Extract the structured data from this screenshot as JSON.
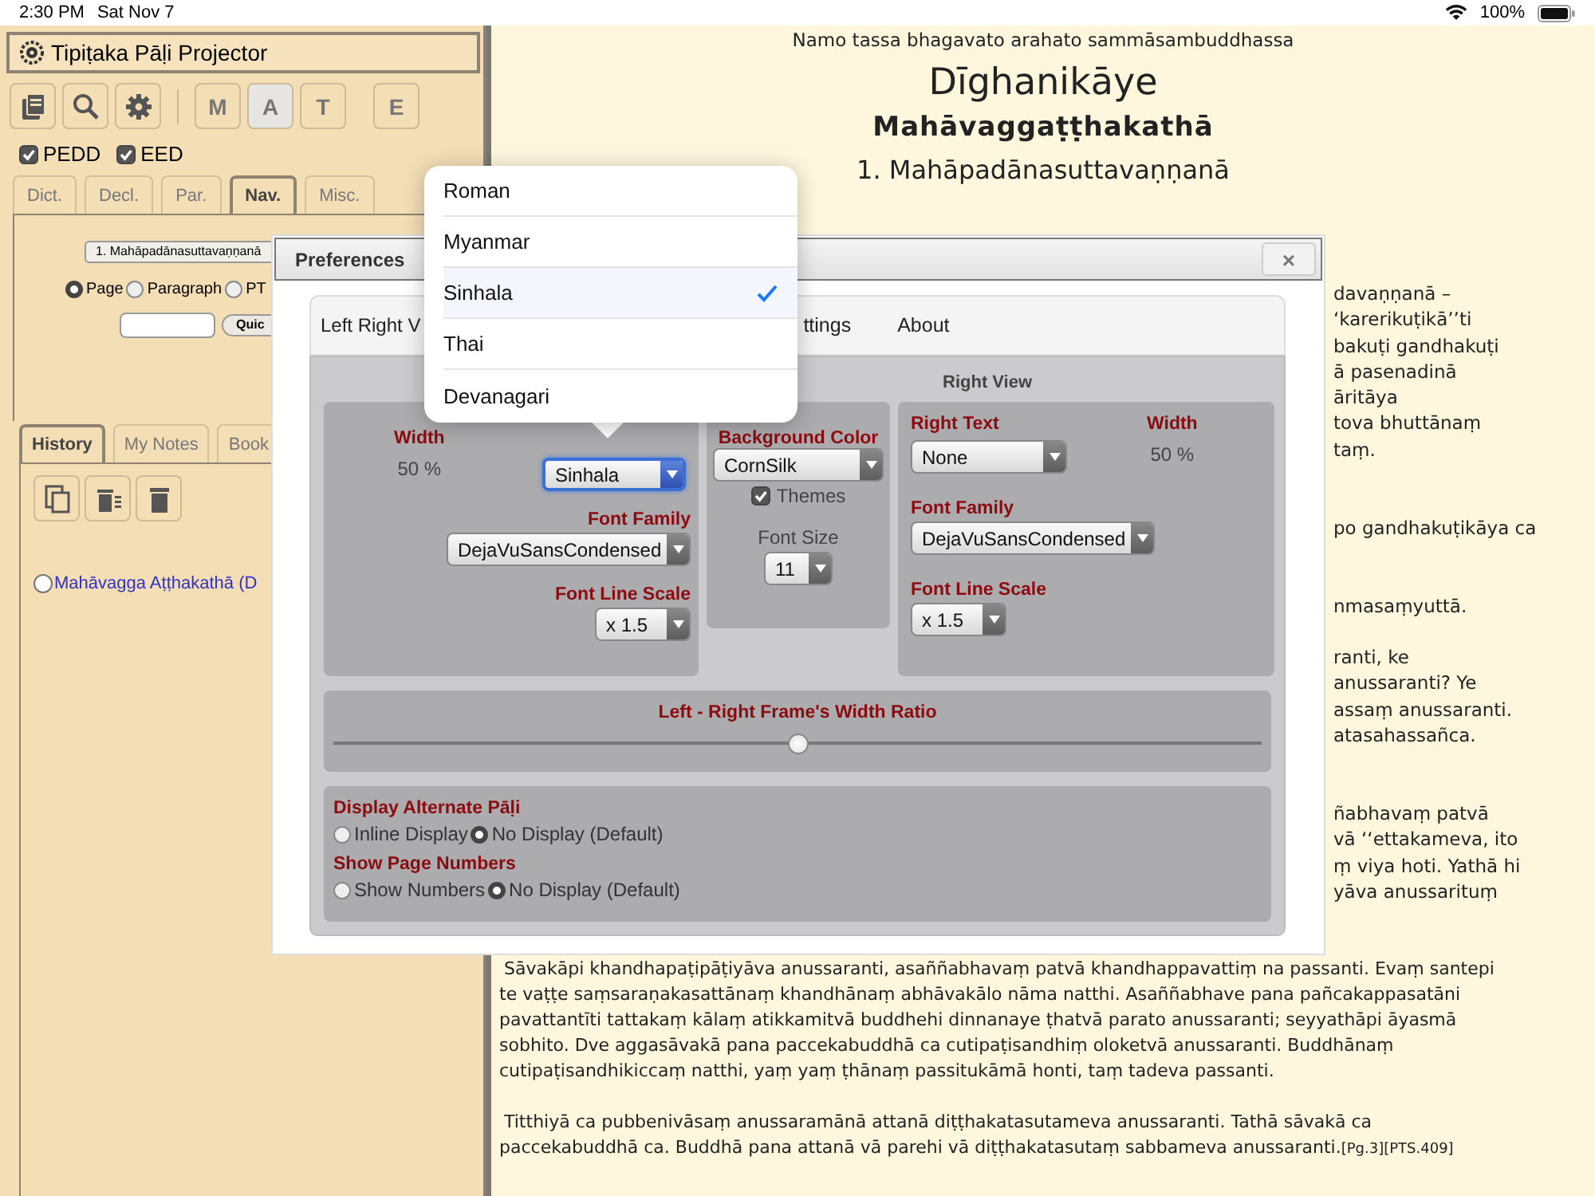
{
  "status_bar": {
    "time": "2:30 PM",
    "date": "Sat Nov 7",
    "battery": "100%"
  },
  "app_title": "Tipiṭaka Pāḷi Projector",
  "toolbar": {
    "icon_buttons": [
      {
        "kind": "books"
      },
      {
        "kind": "search"
      },
      {
        "kind": "settings"
      }
    ],
    "letter_buttons": [
      {
        "label": "M",
        "selected": false
      },
      {
        "label": "A",
        "selected": true
      },
      {
        "label": "T",
        "selected": false
      },
      {
        "label": "E",
        "selected": false
      }
    ]
  },
  "dictionaries": [
    {
      "label": "PEDD",
      "checked": true
    },
    {
      "label": "EED",
      "checked": true
    }
  ],
  "tabs": [
    {
      "label": "Dict.",
      "selected": false
    },
    {
      "label": "Decl.",
      "selected": false
    },
    {
      "label": "Par.",
      "selected": false
    },
    {
      "label": "Nav.",
      "selected": true
    },
    {
      "label": "Misc.",
      "selected": false
    }
  ],
  "nav": {
    "chapter": "1. Mahāpadānasuttavaṇṇanā",
    "modes": [
      {
        "label": "Page",
        "selected": true
      },
      {
        "label": "Paragraph",
        "selected": false
      },
      {
        "label": "PT",
        "selected": false
      }
    ],
    "quick_button": "Quic"
  },
  "notes_tabs": [
    {
      "label": "History",
      "selected": true
    },
    {
      "label": "My Notes",
      "selected": false
    },
    {
      "label": "Book",
      "selected": false
    }
  ],
  "notes_tools": [
    {
      "kind": "copy"
    },
    {
      "kind": "clear"
    },
    {
      "kind": "delete"
    }
  ],
  "history": [
    {
      "label": "Mahāvagga Aṭṭhakathā (D",
      "checked": false
    }
  ],
  "reader": {
    "invocation": "Namo tassa bhagavato arahato sammāsambuddhassa",
    "collection": "Dīghanikāye",
    "book": "Mahāvaggaṭṭhakathā",
    "chapter": "1. Mahāpadānasuttavaṇṇanā",
    "visible_fragments": [
      [
        "davaṇṇanā –",
        "‘karerikuṭikā’’ti",
        "bakuṭi gandhakuṭi",
        "ā pasenadinā",
        "āritāya",
        "tova bhuttānaṃ",
        "taṃ."
      ],
      [
        "po gandhakuṭikāya ca"
      ],
      [
        "nmasaṃyuttā."
      ],
      [
        "ranti, ke",
        "anussaranti? Ye",
        "assaṃ anussaranti.",
        "atasahassañca."
      ],
      [
        "ñabhavaṃ patvā",
        "vā ‘‘ettakameva, ito",
        "ṃ viya hoti. Yathā hi",
        "yāva anussarituṃ"
      ]
    ],
    "paragraphs": [
      {
        "text": "Sāvakāpi khandhapaṭipāṭiyāva anussaranti, asaññabhavaṃ patvā khandhappavattiṃ na passanti. Evaṃ santepi te vaṭṭe saṃsaraṇakasattānaṃ khandhānaṃ abhāvakālo nāma natthi. Asaññabhave pana pañcakappasatāni pavattantīti tattakaṃ kālaṃ atikkamitvā buddhehi dinnanaye ṭhatvā parato anussaranti; seyyathāpi āyasmā sobhito. Dve aggasāvakā pana paccekabuddhā ca cutipaṭisandhiṃ oloketvā anussaranti. Buddhānaṃ cutipaṭisandhikiccaṃ natthi, yaṃ yaṃ ṭhānaṃ passitukāmā honti, taṃ tadeva passanti."
      },
      {
        "text": "Titthiyā ca pubbenivāsaṃ anussaramānā attanā diṭṭhakatasutameva anussaranti. Tathā sāvakā ca paccekabuddhā ca. Buddhā pana attanā vā parehi vā diṭṭhakatasutaṃ sabbameva anussaranti.",
        "marks": "[Pg.3][PTS.409]"
      }
    ]
  },
  "preferences": {
    "title": "Preferences",
    "close": "×",
    "tabs": [
      "Left Right V",
      "ttings",
      "About"
    ],
    "right_view_heading": "Right View",
    "left": {
      "width_label": "Width",
      "width_value": "50 %",
      "text_select": "Sinhala",
      "font_family_label": "Font Family",
      "font_family": "DejaVuSansCondensed",
      "line_scale_label": "Font Line Scale",
      "line_scale": "x 1.5"
    },
    "middle": {
      "background_label": "Background Color",
      "background": "CornSilk",
      "themes": {
        "label": "Themes",
        "checked": true
      },
      "font_size_label": "Font Size",
      "font_size": "11"
    },
    "right": {
      "text_label": "Right Text",
      "text_select": "None",
      "width_label": "Width",
      "width_value": "50 %",
      "font_family_label": "Font Family",
      "font_family": "DejaVuSansCondensed",
      "line_scale_label": "Font Line Scale",
      "line_scale": "x 1.5"
    },
    "ratio": {
      "label": "Left - Right Frame's Width Ratio",
      "level": 0.5
    },
    "options": [
      {
        "label": "Display Alternate Pāḷi",
        "choices": [
          {
            "label": "Inline Display",
            "selected": false
          },
          {
            "label": "No Display (Default)",
            "selected": true
          }
        ]
      },
      {
        "label": "Show Page Numbers",
        "choices": [
          {
            "label": "Show Numbers",
            "selected": false
          },
          {
            "label": "No Display (Default)",
            "selected": true
          }
        ]
      }
    ]
  },
  "language_menu": {
    "items": [
      {
        "label": "Roman",
        "selected": false
      },
      {
        "label": "Myanmar",
        "selected": false
      },
      {
        "label": "Sinhala",
        "selected": true
      },
      {
        "label": "Thai",
        "selected": false
      },
      {
        "label": "Devanagari",
        "selected": false
      }
    ]
  }
}
